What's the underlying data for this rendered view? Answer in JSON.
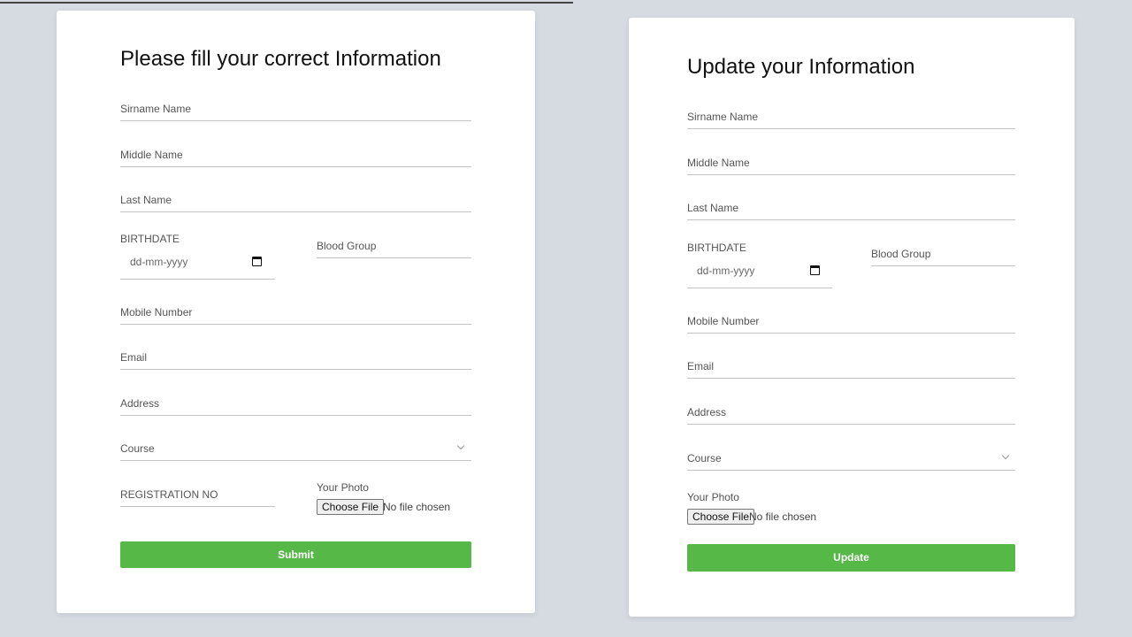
{
  "left_form": {
    "title": "Please fill your correct Information",
    "surname_label": "Sirname Name",
    "middle_label": "Middle Name",
    "last_label": "Last Name",
    "birthdate_label": "BIRTHDATE",
    "birthdate_placeholder": "dd-mm-yyyy",
    "blood_group_label": "Blood Group",
    "mobile_label": "Mobile Number",
    "email_label": "Email",
    "address_label": "Address",
    "course_label": "Course",
    "registration_label": "REGISTRATION NO",
    "photo_label": "Your Photo",
    "choose_file_label": "Choose File",
    "no_file_text": "No file chosen",
    "submit_label": "Submit"
  },
  "right_form": {
    "title": "Update your Information",
    "surname_label": "Sirname Name",
    "middle_label": "Middle Name",
    "last_label": "Last Name",
    "birthdate_label": "BIRTHDATE",
    "birthdate_placeholder": "dd-mm-yyyy",
    "blood_group_label": "Blood Group",
    "mobile_label": "Mobile Number",
    "email_label": "Email",
    "address_label": "Address",
    "course_label": "Course",
    "photo_label": "Your Photo",
    "choose_file_label": "Choose File",
    "no_file_text": "No file chosen",
    "update_label": "Update"
  },
  "colors": {
    "background": "#d6dae1",
    "card": "#ffffff",
    "button_green": "#56b847",
    "underline": "#c4c4c4"
  },
  "icons": {
    "calendar": "calendar-icon",
    "dropdown": "chevron-down-icon"
  }
}
